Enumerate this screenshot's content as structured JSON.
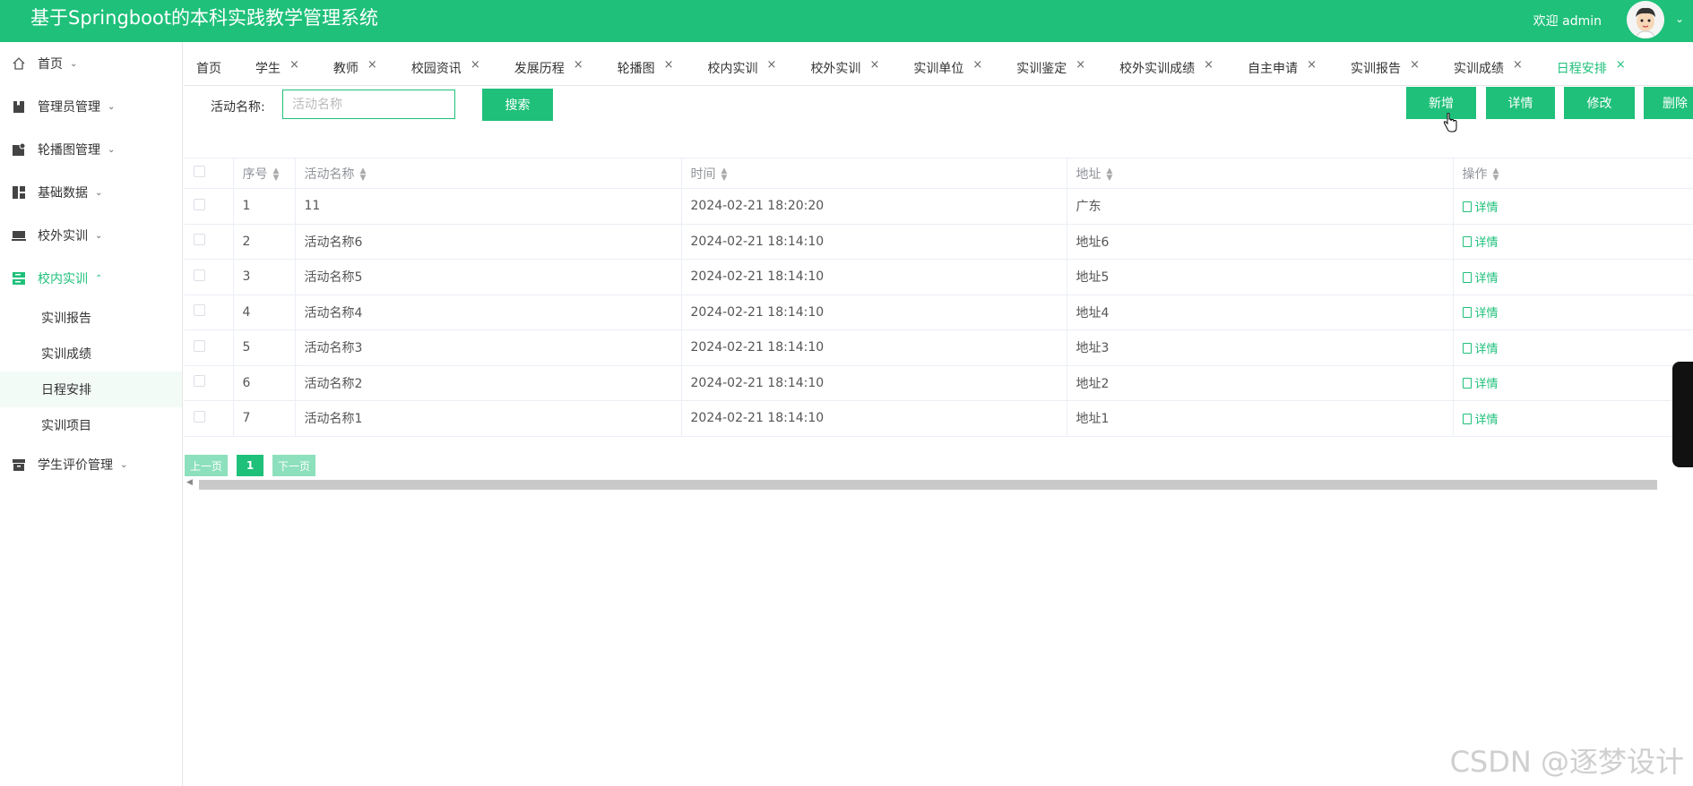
{
  "header": {
    "title": "基于Springboot的本科实践教学管理系统",
    "welcome": "欢迎 admin",
    "avatar": "avatar",
    "caret": "chevron-down-icon"
  },
  "sidebar": {
    "items": [
      {
        "label": "首页",
        "icon": "home-icon"
      },
      {
        "label": "管理员管理",
        "icon": "bookmark-icon"
      },
      {
        "label": "轮播图管理",
        "icon": "image-icon"
      },
      {
        "label": "基础数据",
        "icon": "dashboard-icon"
      },
      {
        "label": "校外实训",
        "icon": "laptop-icon"
      },
      {
        "label": "校内实训",
        "icon": "server-icon"
      },
      {
        "label": "学生评价管理",
        "icon": "archive-icon"
      }
    ],
    "subitems": [
      "实训报告",
      "实训成绩",
      "日程安排",
      "实训项目"
    ]
  },
  "tabs": [
    "首页",
    "学生",
    "教师",
    "校园资讯",
    "发展历程",
    "轮播图",
    "校内实训",
    "校外实训",
    "实训单位",
    "实训鉴定",
    "校外实训成绩",
    "自主申请",
    "实训报告",
    "实训成绩",
    "日程安排"
  ],
  "search": {
    "label": "活动名称:",
    "placeholder": "活动名称",
    "button": "搜索"
  },
  "actions": {
    "add": "新增",
    "detail": "详情",
    "edit": "修改",
    "delete": "删除"
  },
  "table": {
    "columns": [
      "序号",
      "活动名称",
      "时间",
      "地址",
      "操作"
    ],
    "op_label": "详情",
    "rows": [
      [
        "1",
        "11",
        "2024-02-21 18:20:20",
        "广东"
      ],
      [
        "2",
        "活动名称6",
        "2024-02-21 18:14:10",
        "地址6"
      ],
      [
        "3",
        "活动名称5",
        "2024-02-21 18:14:10",
        "地址5"
      ],
      [
        "4",
        "活动名称4",
        "2024-02-21 18:14:10",
        "地址4"
      ],
      [
        "5",
        "活动名称3",
        "2024-02-21 18:14:10",
        "地址3"
      ],
      [
        "6",
        "活动名称2",
        "2024-02-21 18:14:10",
        "地址2"
      ],
      [
        "7",
        "活动名称1",
        "2024-02-21 18:14:10",
        "地址1"
      ]
    ]
  },
  "pager": {
    "prev": "上一页",
    "current": "1",
    "next": "下一页"
  },
  "watermark": "CSDN @逐梦设计",
  "colors": {
    "primary": "#1fc07a",
    "pager_disabled": "#8de0bc"
  }
}
